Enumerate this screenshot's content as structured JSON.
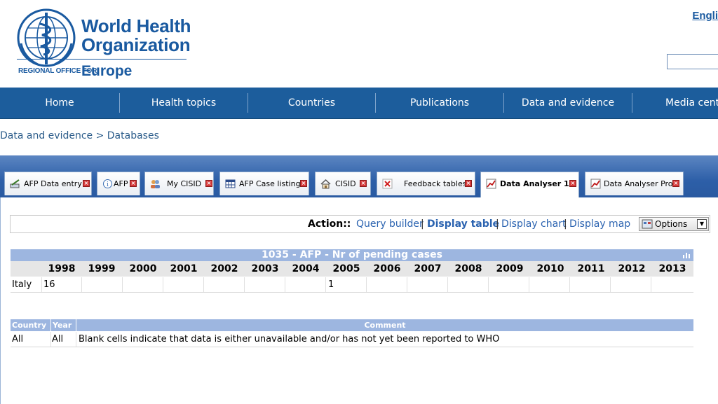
{
  "header": {
    "org_line1": "World Health",
    "org_line2": "Organization",
    "region_label": "REGIONAL OFFICE FOR",
    "region_name": "Europe",
    "language_link": "Engli",
    "brand_color": "#1a5aa0"
  },
  "nav": {
    "items": [
      {
        "label": "Home"
      },
      {
        "label": "Health topics"
      },
      {
        "label": "Countries"
      },
      {
        "label": "Publications"
      },
      {
        "label": "Data and evidence"
      },
      {
        "label": "Media centr"
      }
    ],
    "bg_color": "#1c5d9c"
  },
  "breadcrumb": {
    "parent": "Data and evidence",
    "separator": ">",
    "current": "Databases"
  },
  "tabs": [
    {
      "label": "AFP Data entry",
      "icon": "data-entry-icon"
    },
    {
      "label": "AFP",
      "icon": "info-icon"
    },
    {
      "label": "My CISID",
      "icon": "users-icon"
    },
    {
      "label": "AFP Case listing",
      "icon": "table-icon"
    },
    {
      "label": "CISID",
      "icon": "home-icon"
    },
    {
      "label": "Feedback tables",
      "icon": "x-icon"
    },
    {
      "label": "Data Analyser 1",
      "icon": "chart-icon",
      "active": true
    },
    {
      "label": "Data Analyser Pro",
      "icon": "chart-icon"
    }
  ],
  "actions": {
    "label": "Action::",
    "links": [
      "Query builder",
      "Display table",
      "Display chart",
      "Display map"
    ],
    "active": "Display table",
    "separator": "|",
    "options_label": "Options"
  },
  "data_table": {
    "title": "1035 - AFP - Nr of pending cases",
    "years": [
      "1998",
      "1999",
      "2000",
      "2001",
      "2002",
      "2003",
      "2004",
      "2005",
      "2006",
      "2007",
      "2008",
      "2009",
      "2010",
      "2011",
      "2012",
      "2013"
    ],
    "rows": [
      {
        "country": "Italy",
        "values": [
          "16",
          "",
          "",
          "",
          "",
          "",
          "",
          "1",
          "",
          "",
          "",
          "",
          "",
          "",
          "",
          ""
        ]
      }
    ]
  },
  "comment_table": {
    "headers": {
      "country": "Country",
      "year": "Year",
      "comment": "Comment"
    },
    "rows": [
      {
        "country": "All",
        "year": "All",
        "comment": "Blank cells indicate that data is either unavailable and/or has not yet been reported to WHO"
      }
    ]
  }
}
